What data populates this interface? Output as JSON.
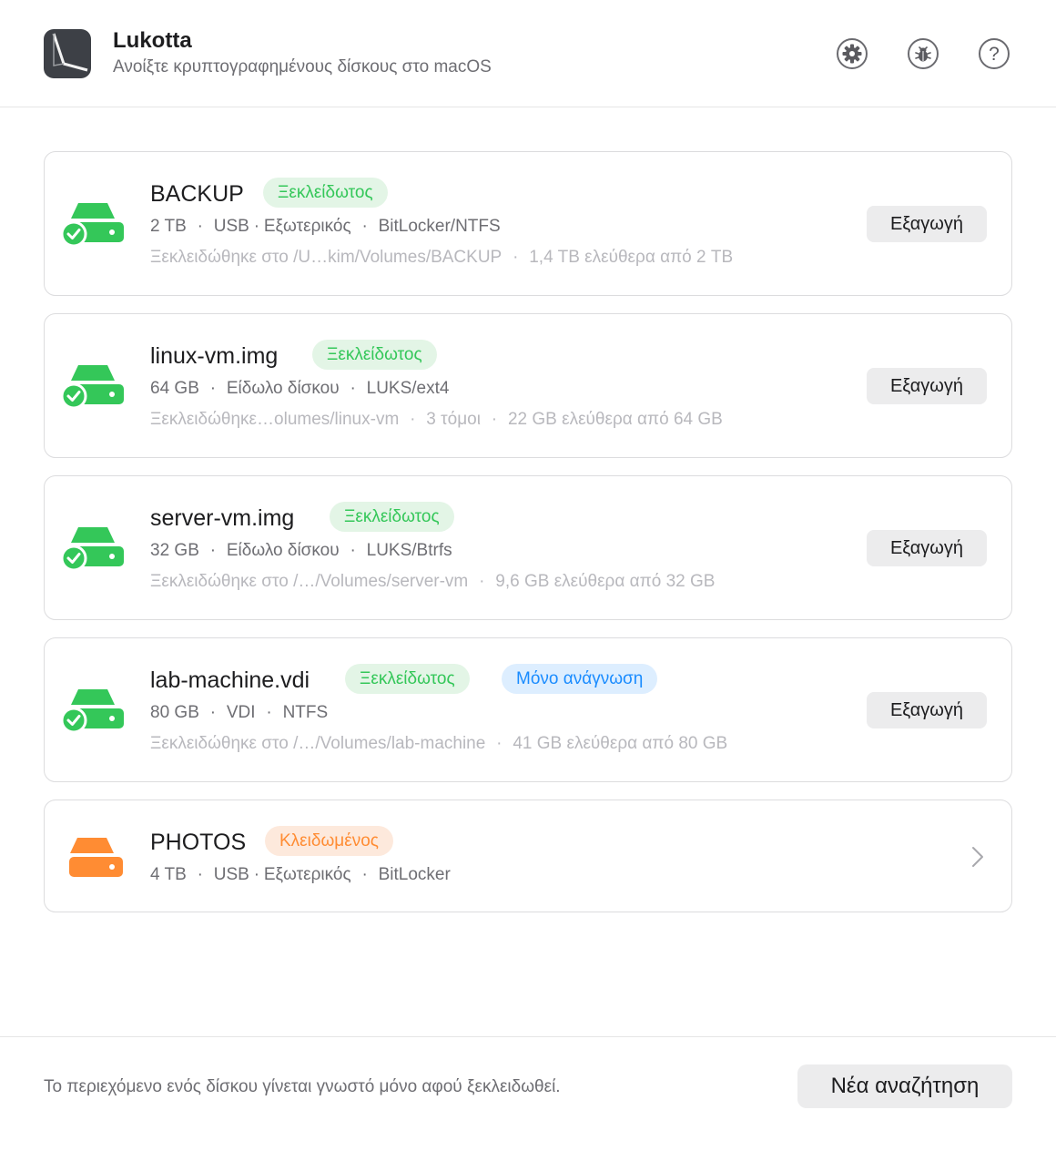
{
  "app": {
    "title": "Lukotta",
    "subtitle": "Ανοίξτε κρυπτογραφημένους δίσκους στο macOS",
    "icons": [
      "settings-gear-icon",
      "bug-icon",
      "help-icon"
    ],
    "help_glyph": "?"
  },
  "colors": {
    "unlocked": "#34c759",
    "locked": "#ff8c33",
    "readonly": "#1a8cff",
    "button_bg": "#ececed"
  },
  "drives": [
    {
      "name": "BACKUP",
      "status": "Ξεκλείδωτος",
      "state": "unlocked",
      "icon": "drive-unlocked-icon",
      "size": "2 TB",
      "connection": "USB",
      "location": "Εξωτερικός",
      "format": "BitLocker/NTFS",
      "mount": "Ξεκλειδώθηκε στο /U…kim/Volumes/BACKUP",
      "free": "1,4 TB ελεύθερα από 2 TB",
      "action": "Εξαγωγή"
    },
    {
      "name": "linux-vm.img",
      "status": "Ξεκλείδωτος",
      "state": "unlocked",
      "icon": "drive-unlocked-icon",
      "size": "64 GB",
      "type": "Είδωλο δίσκου",
      "format": "LUKS/ext4",
      "mount": "Ξεκλειδώθηκε…olumes/linux-vm",
      "volumes": "3 τόμοι",
      "free": "22 GB ελεύθερα από 64 GB",
      "action": "Εξαγωγή"
    },
    {
      "name": "server-vm.img",
      "status": "Ξεκλείδωτος",
      "state": "unlocked",
      "icon": "drive-unlocked-icon",
      "size": "32 GB",
      "type": "Είδωλο δίσκου",
      "format": "LUKS/Btrfs",
      "mount": "Ξεκλειδώθηκε στο /…/Volumes/server-vm",
      "free": "9,6 GB ελεύθερα από 32 GB",
      "action": "Εξαγωγή"
    },
    {
      "name": "lab-machine.vdi",
      "status": "Ξεκλείδωτος",
      "extra_badge": "Μόνο ανάγνωση",
      "state": "unlocked",
      "icon": "drive-unlocked-icon",
      "size": "80 GB",
      "type": "VDI",
      "format": "NTFS",
      "mount": "Ξεκλειδώθηκε στο /…/Volumes/lab-machine",
      "free": "41 GB ελεύθερα από 80 GB",
      "action": "Εξαγωγή"
    },
    {
      "name": "PHOTOS",
      "status": "Κλειδωμένος",
      "state": "locked",
      "icon": "drive-locked-icon",
      "size": "4 TB",
      "connection": "USB",
      "location": "Εξωτερικός",
      "format": "BitLocker"
    }
  ],
  "footer": {
    "note": "Το περιεχόμενο ενός δίσκου γίνεται γνωστό μόνο αφού ξεκλειδωθεί.",
    "button": "Νέα αναζήτηση"
  }
}
